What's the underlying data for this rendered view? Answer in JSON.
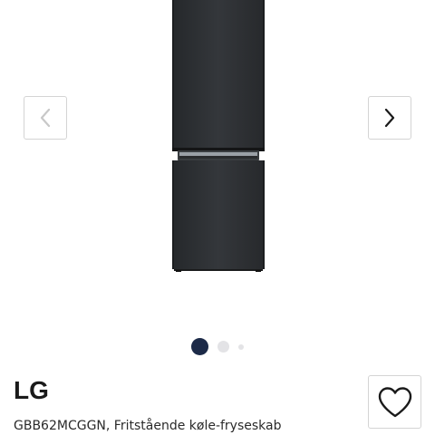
{
  "product": {
    "brand": "LG",
    "title": "GBB62MCGGN, Fritstående køle-fryseskab",
    "image_alt": "LG GBB62MCGGN køle-fryseskab"
  },
  "gallery": {
    "image_count": 3,
    "active_index": 1,
    "prev_icon": "chevron-left-icon",
    "next_icon": "chevron-right-icon"
  },
  "favorite": {
    "icon": "heart-icon"
  },
  "colors": {
    "active_dot": "#1c2a48",
    "inactive_dot": "#e3e3e6",
    "fridge_body": "#2d3033"
  }
}
